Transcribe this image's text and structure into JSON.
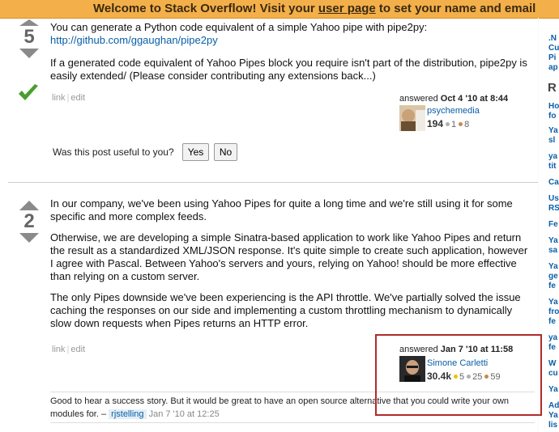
{
  "banner": {
    "prefix": "Welcome to Stack Overflow! Visit your ",
    "link": "user page",
    "suffix": " to set your name and email"
  },
  "answer1": {
    "votes": "5",
    "paragraphs": {
      "p1_text": "You can generate a Python code equivalent of a simple Yahoo pipe with pipe2py: ",
      "p1_link": "http://github.com/ggaughan/pipe2py",
      "p2": "If a generated code equivalent of Yahoo Pipes block you require isn't part of the distribution, pipe2py is easily extended/ (Please consider contributing any extensions back...)"
    },
    "menu": {
      "link": "link",
      "edit": "edit"
    },
    "answered": {
      "label": "answered ",
      "date": "Oct 4 '10 at 8:44"
    },
    "user": {
      "name": "psychemedia",
      "rep": "194",
      "silver": "1",
      "bronze": "8"
    },
    "useful": {
      "question": "Was this post useful to you?",
      "yes": "Yes",
      "no": "No"
    }
  },
  "answer2": {
    "votes": "2",
    "paragraphs": [
      "In our company, we've been using Yahoo Pipes for quite a long time and we're still using it for some specific and more complex feeds.",
      "Otherwise, we are developing a simple Sinatra-based application to work like Yahoo Pipes and return the result as a standardized XML/JSON response. It's quite simple to create such application, however I agree with Pascal. Between Yahoo's servers and yours, relying on Yahoo! should be more effective than relying on a custom server.",
      "The only Pipes downside we've been experiencing is the API throttle. We've partially solved the issue caching the responses on our side and implementing a custom throttling mechanism to dynamically slow down requests when Pipes returns an HTTP error."
    ],
    "menu": {
      "link": "link",
      "edit": "edit"
    },
    "answered": {
      "label": "answered ",
      "date": "Jan 7 '10 at 11:58"
    },
    "user": {
      "name": "Simone Carletti",
      "rep": "30.4k",
      "gold": "5",
      "silver": "25",
      "bronze": "59"
    },
    "comment": {
      "text": "Good to hear a success story. But it would be great to have an open source alternative that you could write your own modules for. – ",
      "user": "rjstelling",
      "date": "Jan 7 '10 at 12:25"
    }
  },
  "sidebar": {
    "items": [
      ".N",
      "Cu",
      "Pi",
      "ap",
      "R",
      "Ho",
      "fo",
      "Ya",
      "sl",
      "ya",
      "tit",
      "Ca",
      "Us",
      "RS",
      "Fe",
      "Ya",
      "sa",
      "Ya",
      "ge",
      "fe",
      "Ya",
      "fro",
      "fe",
      "ya",
      "fe",
      "W",
      "cu",
      "Ya",
      "Ad",
      "Ya",
      "lis"
    ]
  },
  "colors": {
    "banner": "#f3b04a",
    "link": "#0a5ea8",
    "accepted": "#4a9e2f",
    "highlight": "#b22b2b",
    "gold": "#f0c000",
    "silver": "#b0b0b0",
    "bronze": "#c88a4a"
  }
}
